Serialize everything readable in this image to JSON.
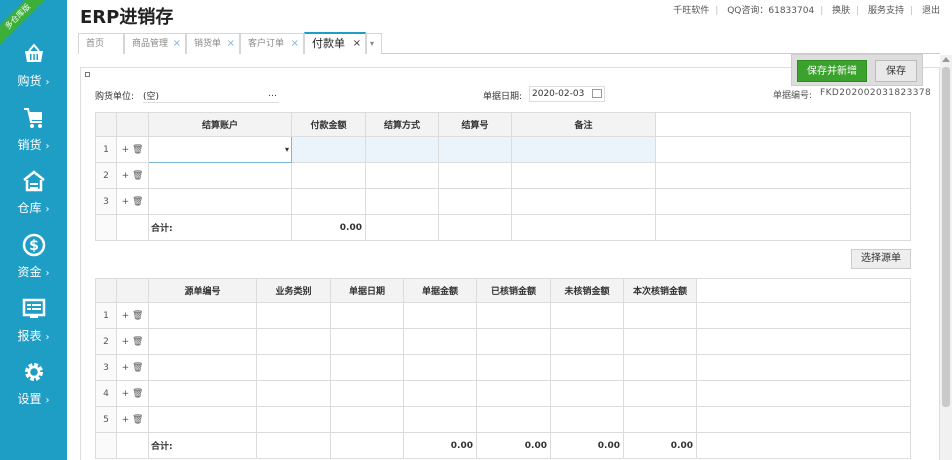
{
  "app": {
    "title": "ERP进销存",
    "ribbon": "多仓库版"
  },
  "toplinks": [
    "千旺软件",
    "QQ咨询：61833704",
    "换肤",
    "服务支持",
    "退出"
  ],
  "sidebar": {
    "items": [
      {
        "label": "购货",
        "icon": "basket-icon"
      },
      {
        "label": "销货",
        "icon": "cart-icon"
      },
      {
        "label": "仓库",
        "icon": "warehouse-icon"
      },
      {
        "label": "资金",
        "icon": "dollar-icon"
      },
      {
        "label": "报表",
        "icon": "report-icon"
      },
      {
        "label": "设置",
        "icon": "gear-icon"
      }
    ],
    "arrow": "›"
  },
  "tabs": [
    {
      "label": "首页",
      "closable": false
    },
    {
      "label": "商品管理",
      "closable": true
    },
    {
      "label": "销货单",
      "closable": true
    },
    {
      "label": "客户订单",
      "closable": true
    },
    {
      "label": "付款单",
      "closable": true,
      "active": true
    }
  ],
  "toolbar": {
    "save_new": "保存并新增",
    "save": "保存"
  },
  "form": {
    "vendor_label": "购货单位:",
    "vendor_value": "(空)",
    "vendor_more": "…",
    "date_label": "单据日期:",
    "date_value": "2020-02-03",
    "no_label": "单据编号:",
    "no_value": "FKD202002031823378"
  },
  "settle_table": {
    "headers": [
      "结算账户",
      "付款金额",
      "结算方式",
      "结算号",
      "备注"
    ],
    "rows": [
      "1",
      "2",
      "3"
    ],
    "total_label": "合计:",
    "total_amount": "0.00"
  },
  "pick_button": "选择源单",
  "source_table": {
    "headers": [
      "源单编号",
      "业务类别",
      "单据日期",
      "单据金额",
      "已核销金额",
      "未核销金额",
      "本次核销金额"
    ],
    "rows": [
      "1",
      "2",
      "3",
      "4",
      "5"
    ],
    "total_label": "合计:",
    "totals": [
      "0.00",
      "0.00",
      "0.00",
      "0.00"
    ]
  },
  "ops": {
    "add": "+",
    "del": "🗑"
  }
}
